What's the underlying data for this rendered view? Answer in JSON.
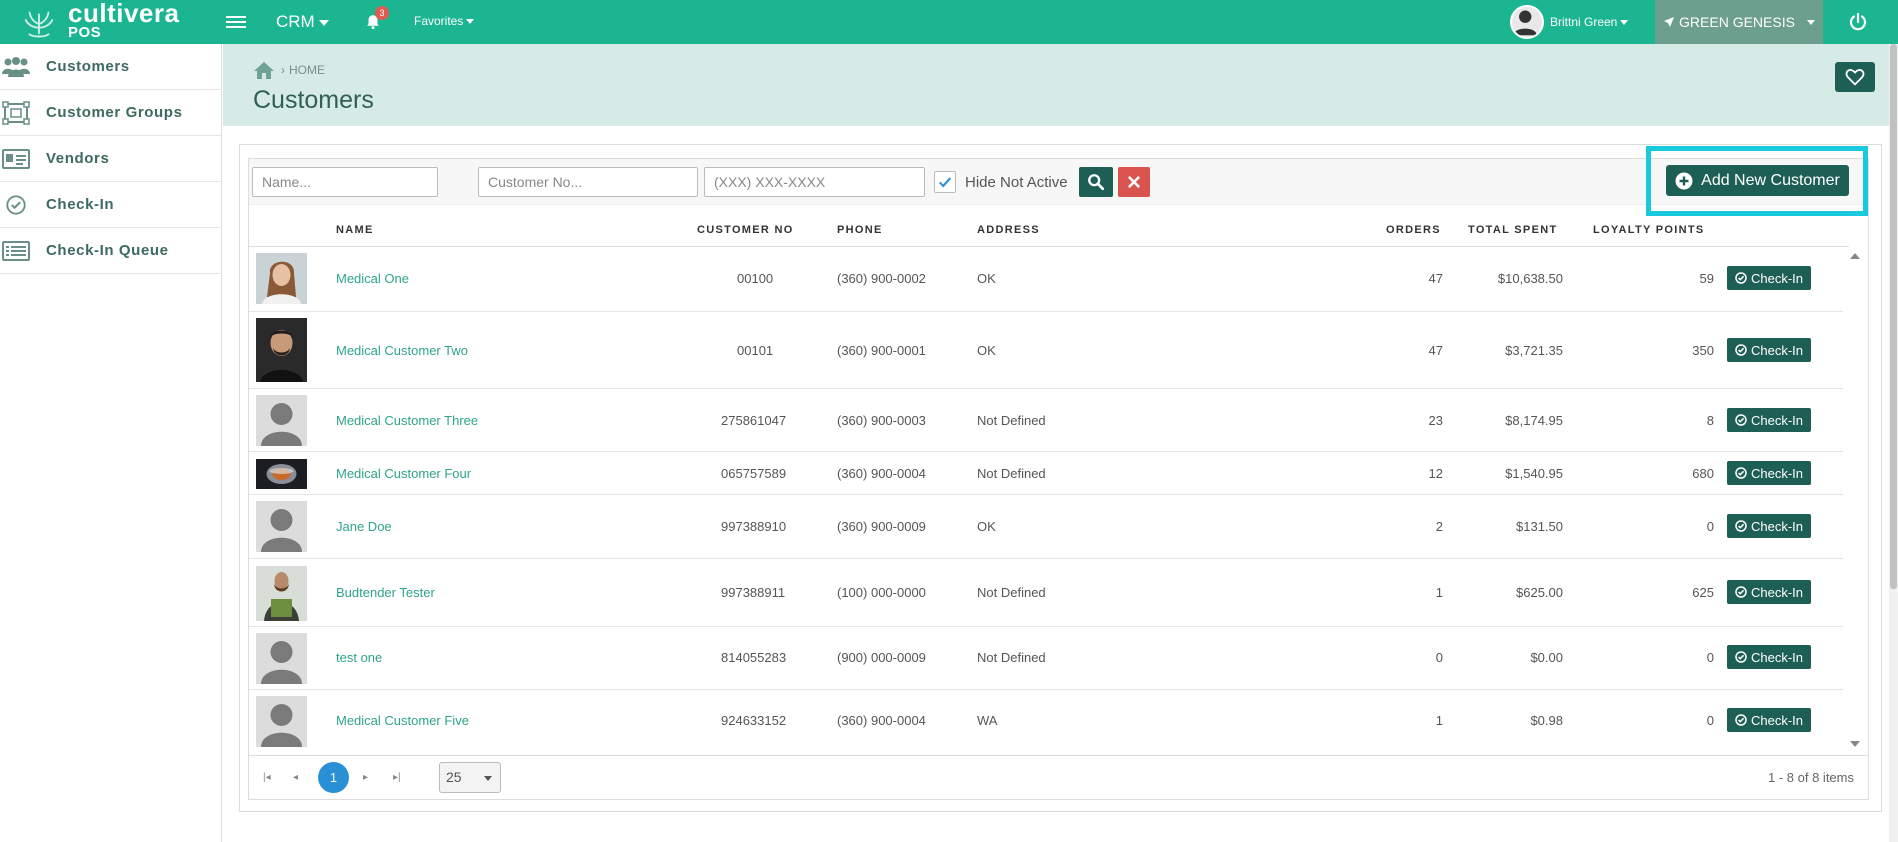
{
  "brand": {
    "name": "cultivera",
    "sub": "POS"
  },
  "topbar": {
    "crm_label": "CRM",
    "notification_count": "3",
    "favorites_label": "Favorites",
    "user_name": "Brittni Green",
    "store_name": "GREEN GENESIS",
    "colors": {
      "bar": "#1cb592",
      "store": "#6d9f8f"
    }
  },
  "sidebar": {
    "items": [
      {
        "label": "Customers",
        "icon": "users-icon"
      },
      {
        "label": "Customer Groups",
        "icon": "group-frame-icon"
      },
      {
        "label": "Vendors",
        "icon": "id-card-icon"
      },
      {
        "label": "Check-In",
        "icon": "check-circle-icon"
      },
      {
        "label": "Check-In Queue",
        "icon": "list-icon"
      }
    ]
  },
  "header": {
    "breadcrumb": "HOME",
    "title": "Customers"
  },
  "filters": {
    "name_placeholder": "Name...",
    "customer_no_placeholder": "Customer No...",
    "phone_placeholder": "(XXX) XXX-XXXX",
    "hide_not_active_label": "Hide Not Active",
    "hide_not_active_checked": true
  },
  "add_button_label": "Add New Customer",
  "table": {
    "columns": {
      "name": "NAME",
      "customer_no": "CUSTOMER NO",
      "phone": "PHONE",
      "address": "ADDRESS",
      "orders": "ORDERS",
      "total_spent": "TOTAL SPENT",
      "loyalty_points": "LOYALTY POINTS"
    },
    "checkin_label": "Check-In",
    "rows": [
      {
        "name": "Medical One",
        "customer_no": "00100",
        "phone": "(360) 900-0002",
        "address": "OK",
        "orders": "47",
        "total_spent": "$10,638.50",
        "loyalty_points": "59",
        "photo": "woman-photo"
      },
      {
        "name": "Medical Customer Two",
        "customer_no": "00101",
        "phone": "(360) 900-0001",
        "address": "OK",
        "orders": "47",
        "total_spent": "$3,721.35",
        "loyalty_points": "350",
        "photo": "man-photo"
      },
      {
        "name": "Medical Customer Three",
        "customer_no": "275861047",
        "phone": "(360) 900-0003",
        "address": "Not Defined",
        "orders": "23",
        "total_spent": "$8,174.95",
        "loyalty_points": "8",
        "photo": "placeholder"
      },
      {
        "name": "Medical Customer Four",
        "customer_no": "065757589",
        "phone": "(360) 900-0004",
        "address": "Not Defined",
        "orders": "12",
        "total_spent": "$1,540.95",
        "loyalty_points": "680",
        "photo": "object-photo"
      },
      {
        "name": "Jane Doe",
        "customer_no": "997388910",
        "phone": "(360) 900-0009",
        "address": "OK",
        "orders": "2",
        "total_spent": "$131.50",
        "loyalty_points": "0",
        "photo": "placeholder"
      },
      {
        "name": "Budtender Tester",
        "customer_no": "997388911",
        "phone": "(100) 000-0000",
        "address": "Not Defined",
        "orders": "1",
        "total_spent": "$625.00",
        "loyalty_points": "625",
        "photo": "budtender-photo"
      },
      {
        "name": "test one",
        "customer_no": "814055283",
        "phone": "(900) 000-0009",
        "address": "Not Defined",
        "orders": "0",
        "total_spent": "$0.00",
        "loyalty_points": "0",
        "photo": "placeholder"
      },
      {
        "name": "Medical Customer Five",
        "customer_no": "924633152",
        "phone": "(360) 900-0004",
        "address": "WA",
        "orders": "1",
        "total_spent": "$0.98",
        "loyalty_points": "0",
        "photo": "placeholder"
      }
    ]
  },
  "pager": {
    "current_page": "1",
    "page_size": "25",
    "info": "1 - 8 of 8 items"
  }
}
